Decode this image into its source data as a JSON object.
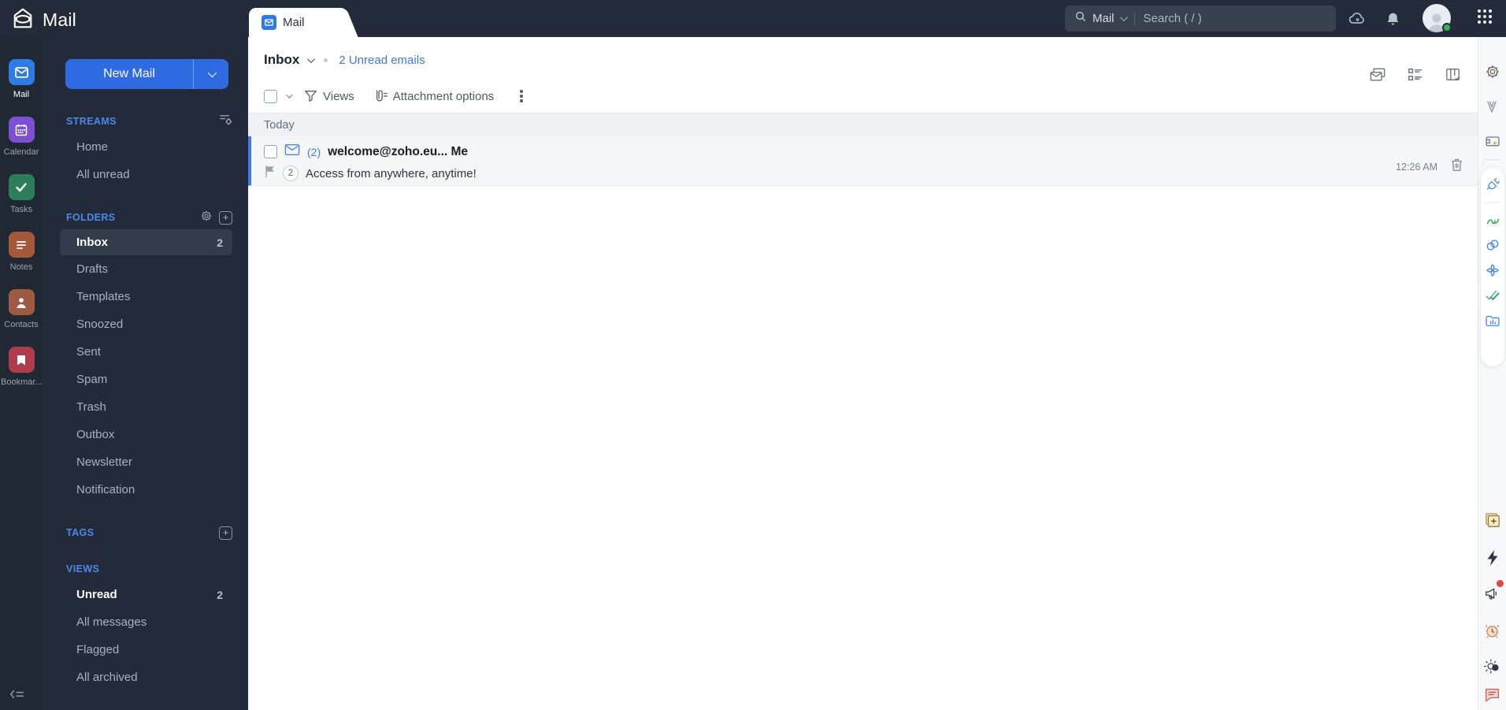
{
  "header": {
    "app_title": "Mail",
    "tab_label": "Mail",
    "search": {
      "scope_label": "Mail",
      "placeholder": "Search ( / )"
    }
  },
  "app_rail": {
    "items": [
      {
        "label": "Mail"
      },
      {
        "label": "Calendar"
      },
      {
        "label": "Tasks"
      },
      {
        "label": "Notes"
      },
      {
        "label": "Contacts"
      },
      {
        "label": "Bookmar..."
      }
    ]
  },
  "nav": {
    "new_mail_label": "New Mail",
    "sections": [
      {
        "title": "STREAMS",
        "items": [
          {
            "label": "Home"
          },
          {
            "label": "All unread"
          }
        ]
      },
      {
        "title": "FOLDERS",
        "items": [
          {
            "label": "Inbox",
            "count": "2"
          },
          {
            "label": "Drafts"
          },
          {
            "label": "Templates"
          },
          {
            "label": "Snoozed"
          },
          {
            "label": "Sent"
          },
          {
            "label": "Spam"
          },
          {
            "label": "Trash"
          },
          {
            "label": "Outbox"
          },
          {
            "label": "Newsletter"
          },
          {
            "label": "Notification"
          }
        ]
      },
      {
        "title": "TAGS",
        "items": []
      },
      {
        "title": "VIEWS",
        "items": [
          {
            "label": "Unread",
            "count": "2"
          },
          {
            "label": "All messages"
          },
          {
            "label": "Flagged"
          },
          {
            "label": "All archived"
          }
        ]
      }
    ]
  },
  "mailbox": {
    "folder_label": "Inbox",
    "unread_summary": "2 Unread emails",
    "toolbar": {
      "views_label": "Views",
      "attachment_label": "Attachment options"
    },
    "group_label": "Today",
    "email": {
      "unread_count": "(2)",
      "sender": "welcome@zoho.eu... Me",
      "thread_count": "2",
      "subject": "Access from anywhere, anytime!",
      "time": "12:26 AM"
    }
  },
  "misc": {
    "plus_glyph": "+"
  },
  "colors": {
    "header_bg": "#232B3A",
    "accent_blue": "#2E6BE2",
    "link_blue": "#3D78E8",
    "unread_bar": "#3F7BEF",
    "selected_bg": "#333C4B"
  }
}
